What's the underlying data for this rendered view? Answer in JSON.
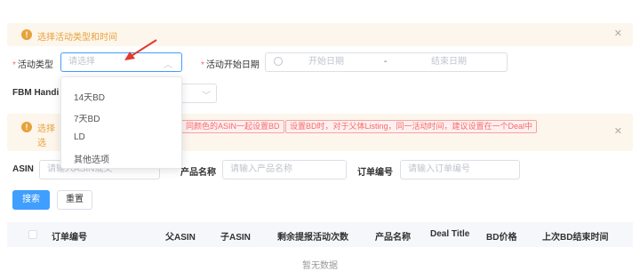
{
  "alert_top": {
    "text": "选择活动类型和时间"
  },
  "form": {
    "activity_type": {
      "label": "活动类型",
      "placeholder": "请选择"
    },
    "activity_start": {
      "label": "活动开始日期",
      "start_placeholder": "开始日期",
      "separator": "-",
      "end_placeholder": "结束日期"
    },
    "fbm_label": "FBM Handi"
  },
  "dropdown": {
    "items": [
      "14天BD",
      "7天BD",
      "LD",
      "其他选项"
    ]
  },
  "alert2": {
    "line1_prefix": "选择",
    "line2_prefix": "选",
    "tags": [
      "同颜色的ASIN一起设置BD",
      "设置BD时，对于父体Listing，同一活动时间，建议设置在一个Deal中"
    ]
  },
  "search": {
    "asin": {
      "label": "ASIN",
      "placeholder": "请输入ASIN或父"
    },
    "product_name": {
      "label": "产品名称",
      "placeholder": "请输入产品名称"
    },
    "order_no": {
      "label": "订单编号",
      "placeholder": "请输入订单编号"
    },
    "search_button": "搜索",
    "reset_button": "重置"
  },
  "table": {
    "columns": [
      "订单编号",
      "父ASIN",
      "子ASIN",
      "剩余提报活动次数",
      "产品名称",
      "Deal Title",
      "BD价格",
      "上次BD结束时间"
    ],
    "empty_text": "暂无数据"
  },
  "colors": {
    "primary": "#409eff",
    "warning": "#e6a23c",
    "danger": "#f56c6c"
  }
}
